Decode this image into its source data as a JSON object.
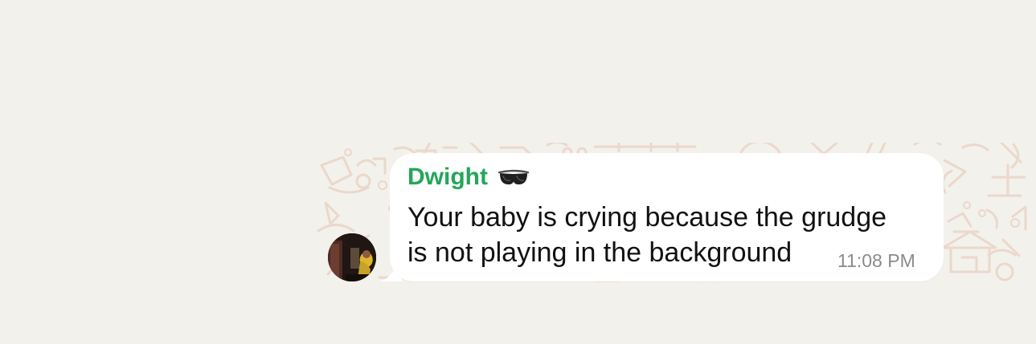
{
  "chat": {
    "message": {
      "sender": "Dwight",
      "sender_icon": "sunglasses-icon",
      "line_1": "Your baby is crying because the grudge",
      "line_2": "is not playing in the background",
      "time": "11:08 PM"
    }
  },
  "colors": {
    "background": "#f3f1ec",
    "bubble": "#ffffff",
    "sender_name": "#25a659",
    "message_text": "#111111",
    "timestamp": "#8b8b8b",
    "wallpaper_doodle": "#ebd7ca"
  }
}
